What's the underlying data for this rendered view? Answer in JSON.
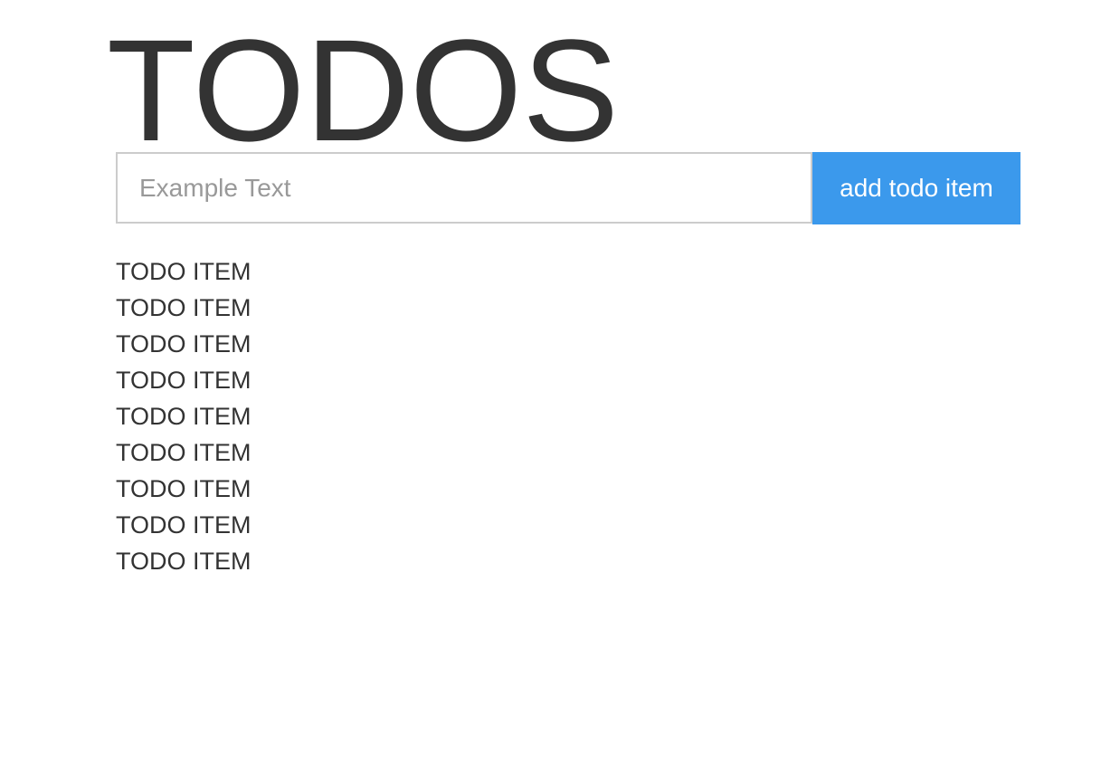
{
  "header": {
    "title": "TODOS"
  },
  "add_form": {
    "input_placeholder": "Example Text",
    "input_value": "",
    "button_label": "add todo item"
  },
  "todos": [
    {
      "label": "TODO ITEM"
    },
    {
      "label": "TODO ITEM"
    },
    {
      "label": "TODO ITEM"
    },
    {
      "label": "TODO ITEM"
    },
    {
      "label": "TODO ITEM"
    },
    {
      "label": "TODO ITEM"
    },
    {
      "label": "TODO ITEM"
    },
    {
      "label": "TODO ITEM"
    },
    {
      "label": "TODO ITEM"
    }
  ],
  "colors": {
    "text": "#333333",
    "button_background": "#3b99ec",
    "button_text": "#ffffff",
    "input_border": "#cccccc",
    "placeholder": "#999999"
  }
}
